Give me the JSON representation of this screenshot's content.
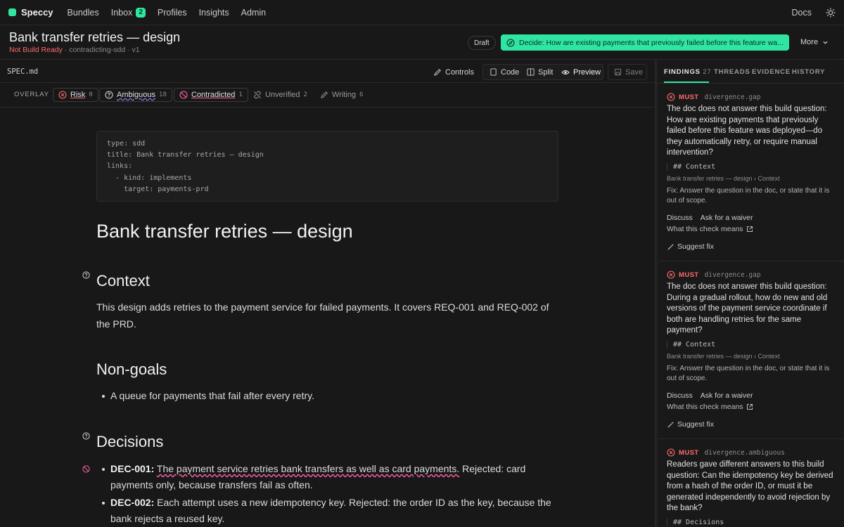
{
  "nav": {
    "brand": "Speccy",
    "links": [
      "Bundles",
      "Inbox",
      "Profiles",
      "Insights",
      "Admin"
    ],
    "inbox_count": "2",
    "docs": "Docs",
    "brand_color": "#2ee6a2"
  },
  "header": {
    "title": "Bank transfer retries — design",
    "status": "Not Build Ready",
    "meta": " · contradicting-sdd · v1",
    "draft": "Draft",
    "decide": "Decide: How are existing payments that previously failed before this feature wa...",
    "more": "More"
  },
  "toolbar": {
    "file": "SPEC.md",
    "controls": "Controls",
    "code": "Code",
    "split": "Split",
    "preview": "Preview",
    "save": "Save"
  },
  "overlay": {
    "label": "OVERLAY",
    "risk": {
      "label": "Risk",
      "count": "0"
    },
    "ambiguous": {
      "label": "Ambiguous",
      "count": "18"
    },
    "contradicted": {
      "label": "Contradicted",
      "count": "1"
    },
    "unverified": {
      "label": "Unverified",
      "count": "2"
    },
    "writing": {
      "label": "Writing",
      "count": "6"
    }
  },
  "doc": {
    "frontmatter": "type: sdd\ntitle: Bank transfer retries — design\nlinks:\n  - kind: implements\n    target: payments-prd",
    "h1": "Bank transfer retries — design",
    "context_heading": "Context",
    "context_text": "This design adds retries to the payment service for failed payments. It covers REQ-001 and REQ-002 of the PRD.",
    "nongoals_heading": "Non-goals",
    "nongoal_1": "A queue for payments that fail after every retry.",
    "decisions_heading": "Decisions",
    "dec1_id": "DEC-001:",
    "dec1_flag": "The payment service retries bank transfers as well as card payments.",
    "dec1_rest": " Rejected: card payments only, because transfers fail as often.",
    "dec2_id": "DEC-002:",
    "dec2_text": " Each attempt uses a new idempotency key. Rejected: the order ID as the key, because the bank rejects a reused key."
  },
  "panel": {
    "tabs": {
      "findings": "FINDINGS",
      "findings_count": "27",
      "threads": "THREADS",
      "evidence": "EVIDENCE",
      "history": "HISTORY"
    },
    "cards": [
      {
        "severity": "MUST",
        "code": "divergence.gap",
        "text": "The doc does not answer this build question: How are existing payments that previously failed before this feature was deployed—do they automatically retry, or require manual intervention?",
        "context": "## Context",
        "crumb": "Bank transfer retries — design › Context",
        "fix": "Fix: Answer the question in the doc, or state that it is out of scope.",
        "discuss": "Discuss",
        "waiver": "Ask for a waiver",
        "meaning": "What this check means",
        "suggest": "Suggest fix"
      },
      {
        "severity": "MUST",
        "code": "divergence.gap",
        "text": "The doc does not answer this build question: During a gradual rollout, how do new and old versions of the payment service coordinate if both are handling retries for the same payment?",
        "context": "## Context",
        "crumb": "Bank transfer retries — design › Context",
        "fix": "Fix: Answer the question in the doc, or state that it is out of scope.",
        "discuss": "Discuss",
        "waiver": "Ask for a waiver",
        "meaning": "What this check means",
        "suggest": "Suggest fix"
      },
      {
        "severity": "MUST",
        "code": "divergence.ambiguous",
        "text": "Readers gave different answers to this build question: Can the idempotency key be derived from a hash of the order ID, or must it be generated independently to avoid rejection by the bank?",
        "context": "## Decisions"
      }
    ]
  },
  "colors": {
    "accent": "#2ee6a2",
    "risk": "#ff6b6b",
    "ambiguous": "#9b7cff",
    "contradicted": "#ff5fa8"
  }
}
